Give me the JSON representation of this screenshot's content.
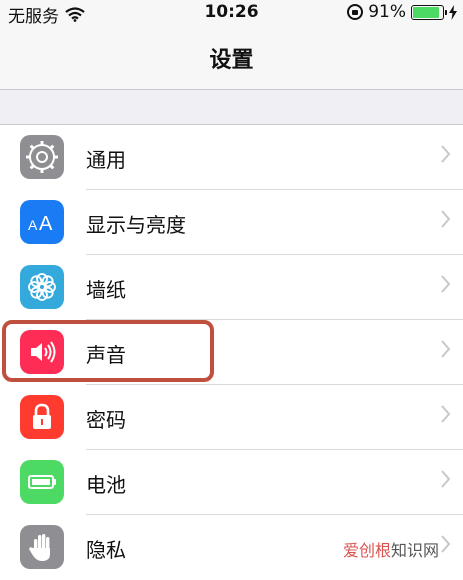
{
  "status_bar": {
    "carrier": "无服务",
    "time": "10:26",
    "battery_percent": "91%",
    "battery_level": 0.91
  },
  "nav": {
    "title": "设置"
  },
  "settings_items": [
    {
      "label": "通用",
      "icon": "gear-icon",
      "color": "#8e8e93"
    },
    {
      "label": "显示与亮度",
      "icon": "text-size-icon",
      "color": "#1a7cf5"
    },
    {
      "label": "墙纸",
      "icon": "flower-icon",
      "color": "#34aadc"
    },
    {
      "label": "声音",
      "icon": "speaker-icon",
      "color": "#ff2d55"
    },
    {
      "label": "密码",
      "icon": "lock-icon",
      "color": "#ff3b30"
    },
    {
      "label": "电池",
      "icon": "battery-icon",
      "color": "#4cd964"
    },
    {
      "label": "隐私",
      "icon": "hand-icon",
      "color": "#8e8e93"
    }
  ],
  "watermark": {
    "brand": "爱创根",
    "suffix": "知识网"
  }
}
